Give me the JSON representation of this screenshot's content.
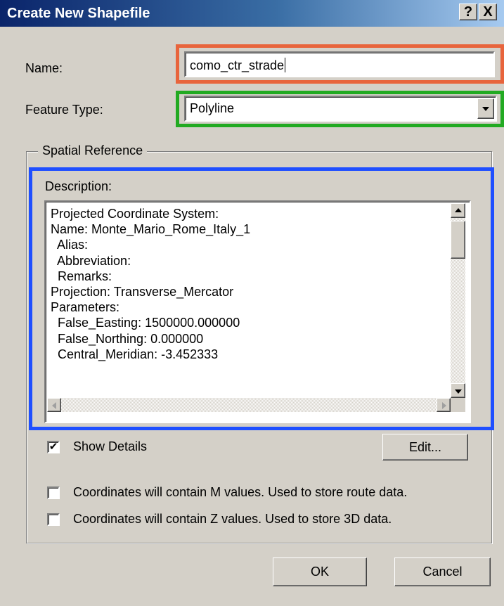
{
  "window": {
    "title": "Create New Shapefile",
    "help_button": "?",
    "close_button": "X"
  },
  "name_field": {
    "label": "Name:",
    "value": "como_ctr_strade",
    "highlight_color": "#e8643c"
  },
  "feature_type": {
    "label": "Feature Type:",
    "selected": "Polyline",
    "highlight_color": "#22aa22"
  },
  "spatial_reference": {
    "group_label": "Spatial Reference",
    "description_label": "Description:",
    "highlight_color": "#1f4fff",
    "description_lines": [
      "Projected Coordinate System:",
      "Name: Monte_Mario_Rome_Italy_1",
      "  Alias:",
      "  Abbreviation:",
      "  Remarks:",
      "Projection: Transverse_Mercator",
      "Parameters:",
      "  False_Easting: 1500000.000000",
      "  False_Northing: 0.000000",
      "  Central_Meridian: -3.452333"
    ],
    "show_details": {
      "label": "Show Details",
      "checked": true,
      "mark": "✔"
    },
    "edit_button": "Edit..."
  },
  "options": {
    "m_values": {
      "label": "Coordinates will contain M values. Used to store route data.",
      "checked": false
    },
    "z_values": {
      "label": "Coordinates will contain Z values. Used to store 3D data.",
      "checked": false
    }
  },
  "buttons": {
    "ok": "OK",
    "cancel": "Cancel"
  },
  "colors": {
    "titlebar_start": "#0a246a",
    "titlebar_end": "#a6caf0",
    "face": "#d4d0c8"
  }
}
